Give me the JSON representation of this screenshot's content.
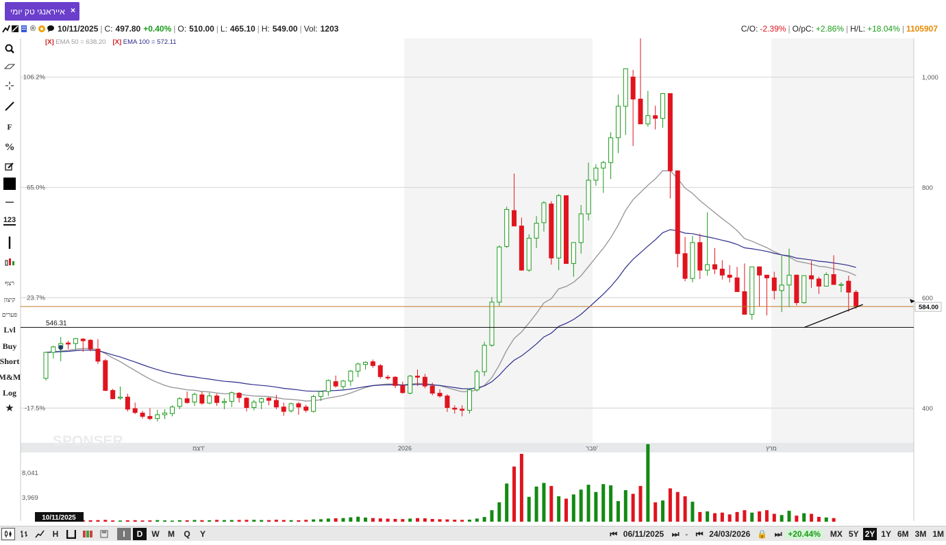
{
  "tab": {
    "title": "אייראנגי טק יומי",
    "close": "×"
  },
  "info": {
    "date": "10/11/2025",
    "close_label": "C:",
    "close": "497.80",
    "change": "+0.40%",
    "open_label": "O:",
    "open": "510.00",
    "low_label": "L:",
    "low": "465.10",
    "high_label": "H:",
    "high": "549.00",
    "vol_label": "Vol:",
    "vol": "1203",
    "co_label": "C/O:",
    "co": "-2.39%",
    "opc_label": "O/pC:",
    "opc": "+2.86%",
    "hl_label": "H/L:",
    "hl": "+18.04%",
    "total_vol": "1105907"
  },
  "ema": [
    {
      "x": "[X]",
      "label": "EMA 50 = 638.20",
      "color": "#9a9a9a"
    },
    {
      "x": "[X]",
      "label": "EMA 100 = 572.11",
      "color": "#2b2b8c"
    }
  ],
  "toolbar": {
    "f": "F",
    "percent": "%",
    "num": "123",
    "heb1": "רצף",
    "heb2": "קיצון",
    "heb3": "פערים",
    "lvl": "Lvl",
    "buy": "Buy",
    "short": "Short",
    "mm": "M&M",
    "log": "Log"
  },
  "bottombar": {
    "periods": [
      "I",
      "D",
      "W",
      "M",
      "Q",
      "Y"
    ],
    "selected_period": "D",
    "from_date": "06/11/2025",
    "dash": "-",
    "to_date": "24/03/2026",
    "range_change": "+20.44%",
    "ranges": [
      "MX",
      "5Y",
      "2Y",
      "1Y",
      "6M",
      "3M",
      "1M"
    ],
    "selected_range": "2Y"
  },
  "chart_data": {
    "type": "candlestick",
    "y_axis_right": {
      "ticks": [
        "1,000",
        "800",
        "600",
        "400"
      ],
      "tick_values": [
        1000,
        800,
        600,
        400
      ]
    },
    "y_axis_left_pct": {
      "ticks": [
        "106.2%",
        "65.0%",
        "23.7%",
        "-17.5%"
      ],
      "tick_values": [
        1000,
        800,
        600,
        400
      ]
    },
    "ylim": [
      337,
      1070
    ],
    "x_labels": [
      "דצמ'",
      "2026",
      "פבר'",
      "מרץ"
    ],
    "last_price_label": "584.00",
    "last_price": 584,
    "level_line_label": "546.31",
    "level_line": 546.31,
    "cursor_date_label": "10/11/2025",
    "volume_ticks": [
      "8,041",
      "3,969"
    ],
    "volume_tick_values": [
      8041,
      3969
    ],
    "watermark": "SPONSER",
    "candles": [
      [
        454,
        501,
        450,
        501
      ],
      [
        501,
        513,
        490,
        511
      ],
      [
        512,
        529,
        485,
        517
      ],
      [
        518,
        522,
        507,
        516
      ],
      [
        517,
        527,
        506,
        526
      ],
      [
        525,
        527,
        502,
        522
      ],
      [
        523,
        525,
        503,
        507
      ],
      [
        507,
        525,
        480,
        485
      ],
      [
        486,
        489,
        431,
        432
      ],
      [
        432,
        435,
        416,
        417
      ],
      [
        418,
        439,
        415,
        420
      ],
      [
        420,
        426,
        394,
        398
      ],
      [
        399,
        410,
        389,
        392
      ],
      [
        391,
        395,
        381,
        385
      ],
      [
        385,
        400,
        378,
        381
      ],
      [
        381,
        397,
        376,
        388
      ],
      [
        388,
        398,
        380,
        391
      ],
      [
        390,
        405,
        385,
        402
      ],
      [
        403,
        420,
        398,
        417
      ],
      [
        417,
        430,
        408,
        410
      ],
      [
        411,
        428,
        404,
        425
      ],
      [
        424,
        430,
        406,
        409
      ],
      [
        409,
        428,
        407,
        422
      ],
      [
        422,
        426,
        404,
        410
      ],
      [
        410,
        418,
        398,
        412
      ],
      [
        412,
        430,
        402,
        428
      ],
      [
        427,
        429,
        410,
        419
      ],
      [
        418,
        420,
        394,
        401
      ],
      [
        401,
        415,
        396,
        411
      ],
      [
        411,
        419,
        398,
        417
      ],
      [
        418,
        420,
        405,
        414
      ],
      [
        414,
        424,
        398,
        402
      ],
      [
        402,
        410,
        386,
        394
      ],
      [
        395,
        410,
        392,
        408
      ],
      [
        408,
        411,
        388,
        402
      ],
      [
        402,
        406,
        392,
        396
      ],
      [
        394,
        424,
        392,
        421
      ],
      [
        421,
        431,
        413,
        430
      ],
      [
        430,
        452,
        422,
        450
      ],
      [
        448,
        459,
        437,
        440
      ],
      [
        439,
        451,
        434,
        449
      ],
      [
        449,
        469,
        440,
        467
      ],
      [
        467,
        482,
        456,
        480
      ],
      [
        479,
        485,
        470,
        483
      ],
      [
        484,
        488,
        473,
        477
      ],
      [
        477,
        480,
        453,
        457
      ],
      [
        456,
        460,
        451,
        455
      ],
      [
        456,
        458,
        436,
        441
      ],
      [
        441,
        448,
        426,
        428
      ],
      [
        427,
        460,
        425,
        458
      ],
      [
        458,
        470,
        440,
        456
      ],
      [
        456,
        462,
        436,
        440
      ],
      [
        440,
        446,
        423,
        427
      ],
      [
        427,
        434,
        419,
        422
      ],
      [
        422,
        425,
        393,
        401
      ],
      [
        400,
        405,
        390,
        398
      ],
      [
        398,
        405,
        385,
        396
      ],
      [
        396,
        435,
        390,
        433
      ],
      [
        433,
        470,
        430,
        466
      ],
      [
        466,
        520,
        458,
        514
      ],
      [
        514,
        601,
        511,
        592
      ],
      [
        592,
        695,
        585,
        692
      ],
      [
        693,
        765,
        690,
        760
      ],
      [
        758,
        825,
        740,
        730
      ],
      [
        730,
        745,
        649,
        650
      ],
      [
        650,
        715,
        647,
        708
      ],
      [
        708,
        748,
        690,
        735
      ],
      [
        736,
        775,
        720,
        772
      ],
      [
        770,
        775,
        660,
        672
      ],
      [
        672,
        788,
        650,
        785
      ],
      [
        785,
        782,
        662,
        662
      ],
      [
        662,
        700,
        638,
        700
      ],
      [
        700,
        768,
        680,
        752
      ],
      [
        752,
        845,
        740,
        813
      ],
      [
        813,
        842,
        803,
        835
      ],
      [
        835,
        848,
        790,
        845
      ],
      [
        845,
        900,
        815,
        890
      ],
      [
        890,
        968,
        862,
        947
      ],
      [
        947,
        1003,
        895,
        1015
      ],
      [
        1000,
        1013,
        875,
        960
      ],
      [
        960,
        1070,
        930,
        915
      ],
      [
        915,
        975,
        910,
        930
      ],
      [
        930,
        948,
        905,
        925
      ],
      [
        925,
        940,
        908,
        970
      ],
      [
        970,
        965,
        780,
        830
      ],
      [
        830,
        780,
        655,
        680
      ],
      [
        680,
        710,
        630,
        635
      ],
      [
        635,
        712,
        628,
        700
      ],
      [
        700,
        716,
        634,
        650
      ],
      [
        650,
        755,
        640,
        660
      ],
      [
        660,
        690,
        643,
        652
      ],
      [
        652,
        668,
        633,
        641
      ],
      [
        641,
        659,
        628,
        637
      ],
      [
        636,
        656,
        626,
        611
      ],
      [
        611,
        662,
        572,
        570
      ],
      [
        570,
        644,
        560,
        656
      ],
      [
        656,
        642,
        584,
        641
      ],
      [
        641,
        628,
        568,
        636
      ],
      [
        636,
        647,
        597,
        613
      ],
      [
        613,
        676,
        574,
        623
      ],
      [
        623,
        689,
        583,
        641
      ],
      [
        641,
        642,
        586,
        591
      ],
      [
        591,
        639,
        589,
        640
      ],
      [
        640,
        667,
        618,
        634
      ],
      [
        634,
        638,
        607,
        621
      ],
      [
        621,
        646,
        622,
        642
      ],
      [
        642,
        677,
        624,
        624
      ],
      [
        624,
        628,
        610,
        624
      ],
      [
        630,
        640,
        575,
        610
      ],
      [
        610,
        614,
        580,
        584
      ]
    ],
    "volumes": [
      1203,
      260,
      240,
      310,
      230,
      280,
      240,
      260,
      300,
      210,
      190,
      230,
      250,
      200,
      220,
      260,
      210,
      180,
      240,
      230,
      280,
      250,
      240,
      300,
      260,
      270,
      280,
      300,
      310,
      270,
      260,
      320,
      280,
      250,
      240,
      300,
      380,
      410,
      520,
      560,
      600,
      720,
      820,
      680,
      600,
      540,
      500,
      460,
      430,
      520,
      590,
      560,
      450,
      410,
      380,
      330,
      300,
      340,
      520,
      780,
      1900,
      3200,
      6300,
      9100,
      11200,
      4100,
      5800,
      6400,
      5900,
      4200,
      3800,
      4500,
      5300,
      6100,
      4900,
      6200,
      6000,
      3400,
      5200,
      4600,
      5900,
      12800,
      3200,
      3500,
      5500,
      4900,
      4200,
      3300,
      1600,
      1700,
      1400,
      1500,
      1200,
      1600,
      1900,
      1500,
      1700,
      1900,
      1300,
      1100,
      1800,
      1000,
      1400,
      1300,
      800,
      700,
      600
    ]
  }
}
